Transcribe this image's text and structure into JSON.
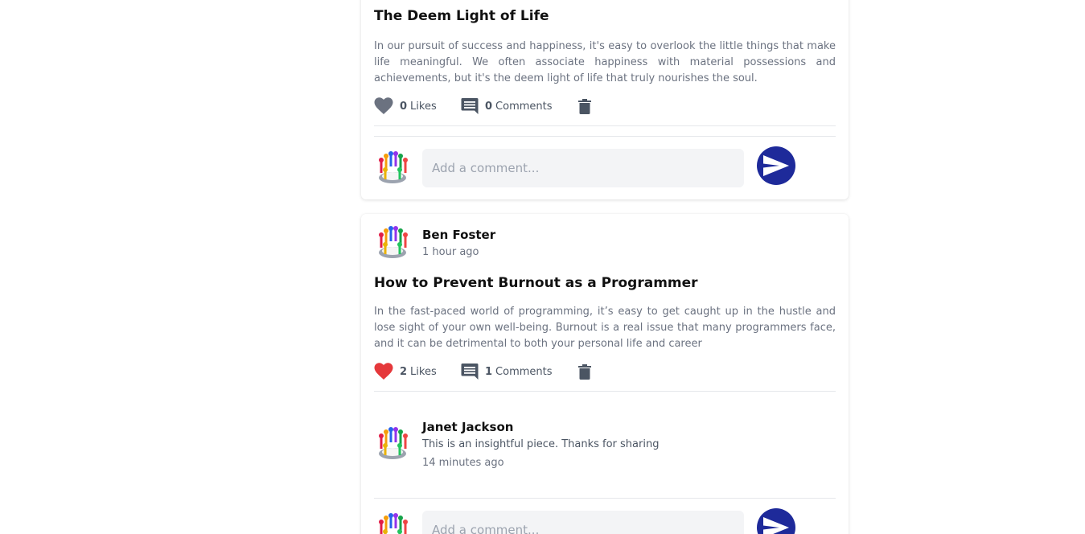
{
  "posts": [
    {
      "title": "The Deem Light of Life",
      "body": "In our pursuit of success and happiness, it's easy to overlook the little things that make life meaningful. We often associate happiness with material possessions and achievements, but it's the deem light of life that truly nourishes the soul.",
      "likes_count": "0",
      "likes_label": "Likes",
      "liked": false,
      "comments_count": "0",
      "comments_label": "Comments",
      "comment_placeholder": "Add a comment..."
    },
    {
      "author": "Ben Foster",
      "time": "1 hour ago",
      "title": "How to Prevent Burnout as a Programmer",
      "body": "In the fast-paced world of programming, it’s easy to get caught up in the hustle and lose sight of your own well-being. Burnout is a real issue that many programmers face, and it can be detrimental to both your personal life and career",
      "likes_count": "2",
      "likes_label": "Likes",
      "liked": true,
      "comments_count": "1",
      "comments_label": "Comments",
      "comments": [
        {
          "author": "Janet Jackson",
          "text": "This is an insightful piece. Thanks for sharing",
          "time": "14 minutes ago"
        }
      ],
      "comment_placeholder": "Add a comment..."
    }
  ],
  "icons": {
    "like": "heart-icon",
    "comment": "comment-icon",
    "delete": "trash-icon",
    "send": "send-icon",
    "avatar": "avatar-image"
  },
  "colors": {
    "liked_heart": "#e5383b",
    "unliked_heart": "#6b7280",
    "send_button": "#1e2a9a",
    "muted_text": "#6b7280"
  }
}
